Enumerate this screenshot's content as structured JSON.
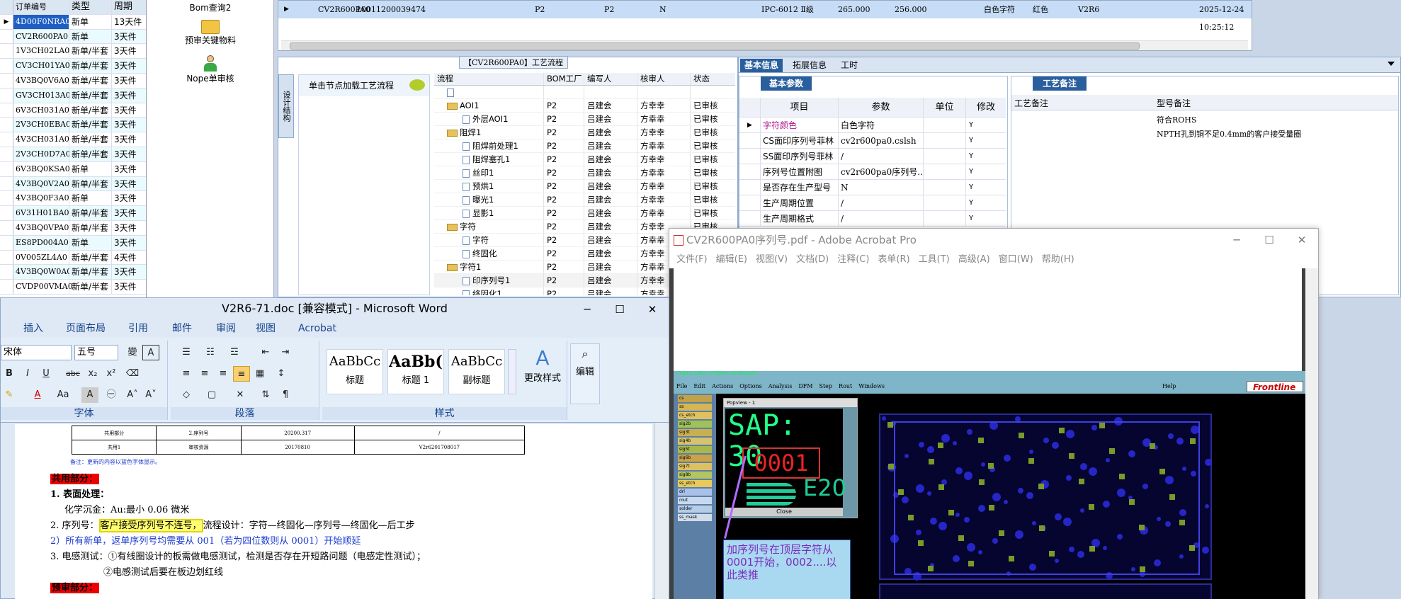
{
  "orders": {
    "headers": [
      "订单编号",
      "类型",
      "周期"
    ],
    "rows": [
      {
        "id": "4D00F0NRA0",
        "type": "新单",
        "cycle": "13天件",
        "selected": true
      },
      {
        "id": "CV2R600PA0",
        "type": "新单",
        "cycle": "3天件"
      },
      {
        "id": "1V3CH02LA0",
        "type": "新单/半套",
        "cycle": "3天件"
      },
      {
        "id": "CV3CH01YA0",
        "type": "新单/半套",
        "cycle": "3天件"
      },
      {
        "id": "4V3BQ0V6A0",
        "type": "新单/半套",
        "cycle": "3天件"
      },
      {
        "id": "GV3CH013A0",
        "type": "新单/半套",
        "cycle": "3天件"
      },
      {
        "id": "6V3CH031A0",
        "type": "新单/半套",
        "cycle": "3天件"
      },
      {
        "id": "2V3CH0EBA0",
        "type": "新单/半套",
        "cycle": "3天件"
      },
      {
        "id": "4V3CH031A0",
        "type": "新单/半套",
        "cycle": "3天件"
      },
      {
        "id": "2V3CH0D7A0",
        "type": "新单/半套",
        "cycle": "3天件"
      },
      {
        "id": "6V3BQ0KSA0",
        "type": "新单",
        "cycle": "3天件"
      },
      {
        "id": "4V3BQ0V2A0",
        "type": "新单/半套",
        "cycle": "3天件"
      },
      {
        "id": "4V3BQ0F3A0",
        "type": "新单",
        "cycle": "3天件"
      },
      {
        "id": "6V31H01BA0",
        "type": "新单/半套",
        "cycle": "3天件"
      },
      {
        "id": "4V3BQ0VPA0",
        "type": "新单/半套",
        "cycle": "3天件"
      },
      {
        "id": "ES8PD004A0",
        "type": "新单",
        "cycle": "3天件"
      },
      {
        "id": "0V005ZL4A0",
        "type": "新单/半套",
        "cycle": "4天件"
      },
      {
        "id": "4V3BQ0W0A0",
        "type": "新单/半套",
        "cycle": "3天件"
      },
      {
        "id": "CVDP00VMA0",
        "type": "新单/半套",
        "cycle": "3天件"
      }
    ]
  },
  "tools": {
    "bom": "Bom查询2",
    "prereview": "预审关键物料",
    "nope": "Nope单审核"
  },
  "topgrid": {
    "row": [
      "CV2R600PA0",
      "10011200039474",
      "P2",
      "P2",
      "N",
      "IPC-6012 Ⅱ级",
      "265.000",
      "256.000",
      "白色字符",
      "红色",
      "V2R6",
      "2025-12-24 10:25:12"
    ]
  },
  "process": {
    "title": "【CV2R600PA0】工艺流程",
    "vtab": "设计结构",
    "load_hint": "单击节点加载工艺流程",
    "headers": [
      "流程",
      "BOM工厂",
      "编写人",
      "核审人",
      "状态"
    ],
    "rows": [
      {
        "name": "",
        "lvl": 1,
        "kind": "doc",
        "f": "",
        "w": "",
        "r": "",
        "s": ""
      },
      {
        "name": "AOI1",
        "lvl": 1,
        "kind": "folder",
        "f": "P2",
        "w": "吕建会",
        "r": "方幸幸",
        "s": "已审核"
      },
      {
        "name": "外层AOI1",
        "lvl": 2,
        "kind": "doc",
        "f": "P2",
        "w": "吕建会",
        "r": "方幸幸",
        "s": "已审核"
      },
      {
        "name": "阻焊1",
        "lvl": 1,
        "kind": "folder",
        "f": "P2",
        "w": "吕建会",
        "r": "方幸幸",
        "s": "已审核"
      },
      {
        "name": "阻焊前处理1",
        "lvl": 2,
        "kind": "doc",
        "f": "P2",
        "w": "吕建会",
        "r": "方幸幸",
        "s": "已审核"
      },
      {
        "name": "阻焊塞孔1",
        "lvl": 2,
        "kind": "doc",
        "f": "P2",
        "w": "吕建会",
        "r": "方幸幸",
        "s": "已审核"
      },
      {
        "name": "丝印1",
        "lvl": 2,
        "kind": "doc",
        "f": "P2",
        "w": "吕建会",
        "r": "方幸幸",
        "s": "已审核"
      },
      {
        "name": "预烘1",
        "lvl": 2,
        "kind": "doc",
        "f": "P2",
        "w": "吕建会",
        "r": "方幸幸",
        "s": "已审核"
      },
      {
        "name": "曝光1",
        "lvl": 2,
        "kind": "doc",
        "f": "P2",
        "w": "吕建会",
        "r": "方幸幸",
        "s": "已审核"
      },
      {
        "name": "显影1",
        "lvl": 2,
        "kind": "doc",
        "f": "P2",
        "w": "吕建会",
        "r": "方幸幸",
        "s": "已审核"
      },
      {
        "name": "字符",
        "lvl": 1,
        "kind": "folder",
        "f": "P2",
        "w": "吕建会",
        "r": "方幸幸",
        "s": "已审核"
      },
      {
        "name": "字符",
        "lvl": 2,
        "kind": "doc",
        "f": "P2",
        "w": "吕建会",
        "r": "方幸幸",
        "s": "已审核"
      },
      {
        "name": "终固化",
        "lvl": 2,
        "kind": "doc",
        "f": "P2",
        "w": "吕建会",
        "r": "方幸幸",
        "s": "已审核"
      },
      {
        "name": "字符1",
        "lvl": 1,
        "kind": "folder",
        "f": "P2",
        "w": "吕建会",
        "r": "方幸幸",
        "s": "已审核"
      },
      {
        "name": "印序列号1",
        "lvl": 2,
        "kind": "doc",
        "f": "P2",
        "w": "吕建会",
        "r": "方幸幸",
        "s": "已审核"
      },
      {
        "name": "终固化1",
        "lvl": 2,
        "kind": "doc",
        "f": "P2",
        "w": "吕建会",
        "r": "方幸幸",
        "s": "已审核"
      }
    ]
  },
  "info": {
    "tabs": [
      "基本信息",
      "拓展信息",
      "工时"
    ],
    "basic_title": "基本参数",
    "param_headers": [
      "项目",
      "参数",
      "单位",
      "修改"
    ],
    "params": [
      {
        "item": "字符颜色",
        "value": "白色字符",
        "unit": "",
        "mod": "Y",
        "highlight": true
      },
      {
        "item": "CS面印序列号菲林",
        "value": "cv2r600pa0.cslsh",
        "unit": "",
        "mod": "Y"
      },
      {
        "item": "SS面印序列号菲林",
        "value": "/",
        "unit": "",
        "mod": "Y"
      },
      {
        "item": "序列号位置附图",
        "value": "cv2r600pa0序列号...",
        "unit": "",
        "mod": "Y"
      },
      {
        "item": "是否存在生产型号",
        "value": "N",
        "unit": "",
        "mod": "Y"
      },
      {
        "item": "生产周期位置",
        "value": "/",
        "unit": "",
        "mod": "Y"
      },
      {
        "item": "生产周期格式",
        "value": "/",
        "unit": "",
        "mod": "Y"
      }
    ],
    "remark_title": "工艺备注",
    "remark_headers": [
      "工艺备注",
      "型号备注"
    ],
    "remark_notes": [
      "符合ROHS",
      "NPTH孔到铜不足0.4mm的客户接受量圈"
    ]
  },
  "acrobat": {
    "title": "CV2R600PA0序列号.pdf - Adobe Acrobat Pro",
    "menu": [
      "文件(F)",
      "编辑(E)",
      "视图(V)",
      "文档(D)",
      "注释(C)",
      "表单(R)",
      "工具(T)",
      "高级(A)",
      "窗口(W)",
      "帮助(H)"
    ],
    "cam_title": "Graphic Editor (V7)(Job=cv2r600pa0)",
    "cam_menu": [
      "File",
      "Edit",
      "Actions",
      "Options",
      "Analysis",
      "DFM",
      "Step",
      "Rout",
      "Windows"
    ],
    "cam_help": "Help",
    "brand": "Frontline",
    "popview_title": "Popview - 1",
    "sap_text": "SAP: 30",
    "serial": "0001",
    "e20": "E20",
    "close": "Close",
    "note": "加序列号在顶层字符从0001开始，0002....以此类推",
    "layers": [
      "cs",
      "ss",
      "cs_etch",
      "sig2b",
      "sig3t",
      "sig4b",
      "sig5t",
      "sig6b",
      "sig7t",
      "sig8b",
      "ss_etch",
      "drl",
      "rout",
      "solder",
      "ss_mask"
    ]
  },
  "word": {
    "title": "V2R6-71.doc [兼容模式] - Microsoft Word",
    "tabs": [
      "插入",
      "页面布局",
      "引用",
      "邮件",
      "审阅",
      "视图",
      "Acrobat"
    ],
    "font_name": "宋体",
    "font_size": "五号",
    "groups": [
      "字体",
      "段落",
      "样式"
    ],
    "styles": [
      {
        "preview": "AaBbCc",
        "name": "标题"
      },
      {
        "preview": "AaBb(",
        "name": "标题 1"
      },
      {
        "preview": "AaBbCc",
        "name": "副标题"
      }
    ],
    "change_style": "更改样式",
    "edit": "编辑",
    "table": [
      [
        "共用部分",
        "2.序列号",
        "20200.317",
        "/"
      ],
      [
        "共用1",
        "审核资源",
        "20170810",
        "V2r6201708017"
      ]
    ],
    "note_small": "备注：更新的内容以蓝色字体显示。",
    "sec_common": "共用部分：",
    "l1": "1. 表面处理：",
    "l1a": "化学沉金：Au:最小 0.06 微米",
    "l2_pre": "2. 序列号：",
    "l2_box": "客户接受序列号不连号，",
    "l2_post": "流程设计：字符—终固化—序列号—终固化—后工步",
    "l3": "2）所有新单，返单序列号均需要从 001（若为四位数则从 0001）开始顺延",
    "l4": "3. 电感测试：①有线圈设计的板需做电感测试，检测是否存在开短路问题（电感定性测试）；",
    "l5": "②电感测试后要在板边划红线",
    "sec_pre": "预审部分："
  }
}
